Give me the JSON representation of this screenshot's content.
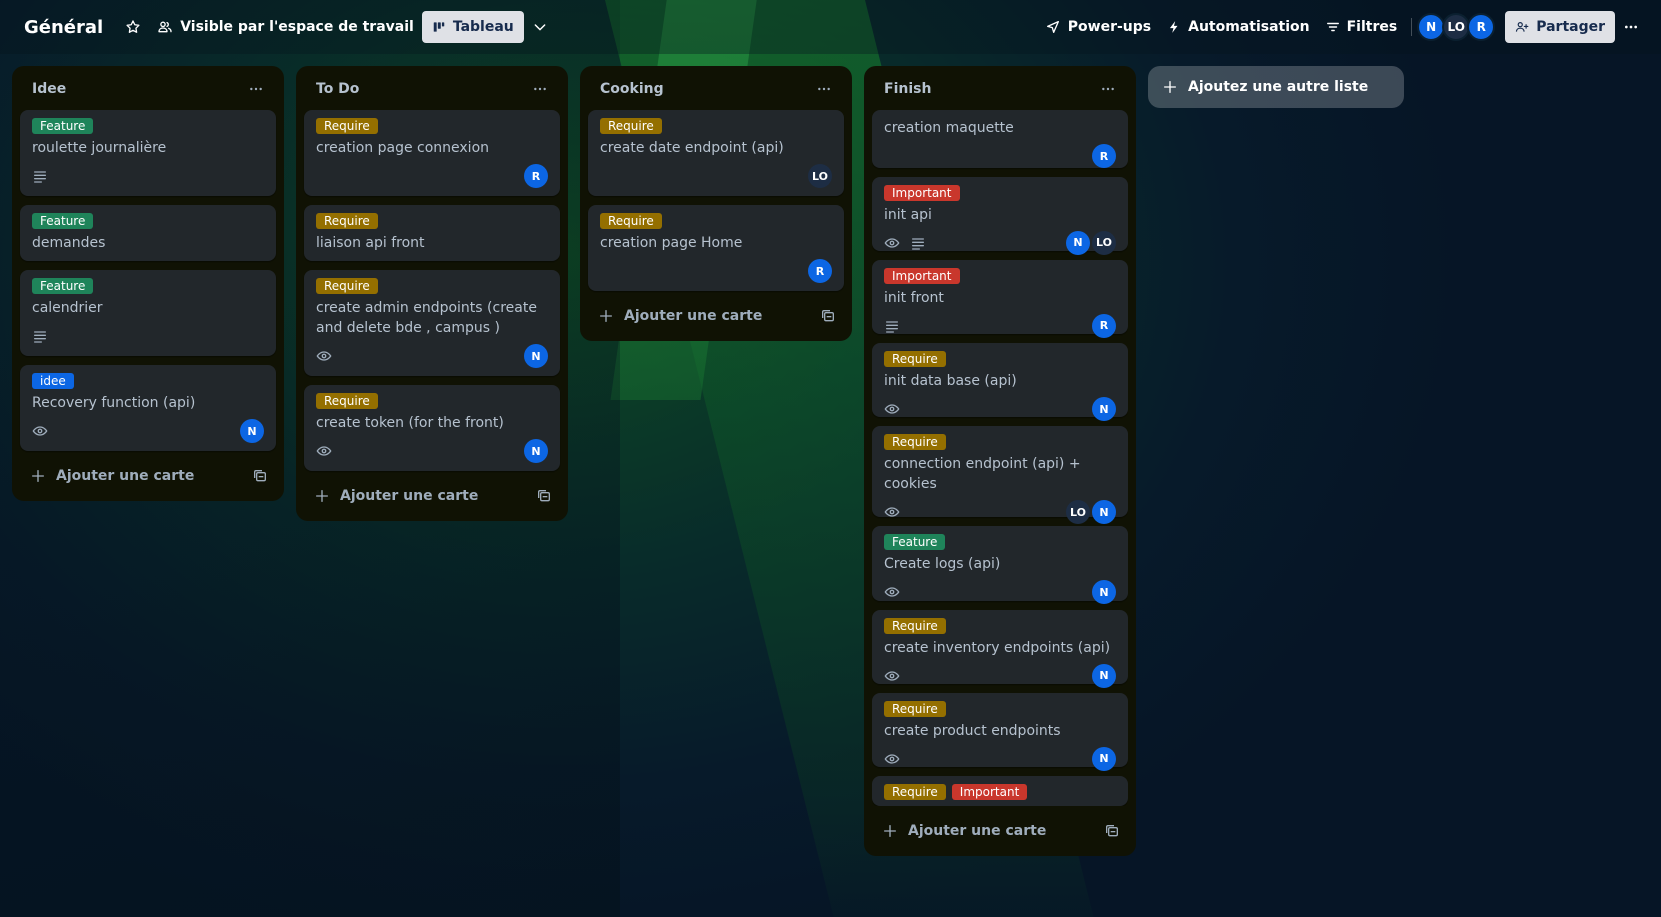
{
  "header": {
    "board_title": "Général",
    "visibility_label": "Visible par l'espace de travail",
    "view_label": "Tableau",
    "powerups_label": "Power-ups",
    "automation_label": "Automatisation",
    "filters_label": "Filtres",
    "share_label": "Partager",
    "members": [
      {
        "initials": "N",
        "color": "#0c66e4"
      },
      {
        "initials": "LO",
        "color": "#1d2d44"
      },
      {
        "initials": "R",
        "color": "#0c66e4"
      }
    ]
  },
  "colors": {
    "feature": "#1f845a",
    "require": "#946f00",
    "important": "#c9372c",
    "idee": "#0c66e4",
    "avatar_blue": "#0c66e4",
    "avatar_dark": "#1d2d44"
  },
  "add_card_label": "Ajouter une carte",
  "add_list_label": "Ajoutez une autre liste",
  "lists": [
    {
      "title": "Idee",
      "cards": [
        {
          "labels": [
            {
              "text": "Feature",
              "color": "#1f845a"
            }
          ],
          "title": "roulette journalière",
          "badges": [
            "description-icon"
          ],
          "members": []
        },
        {
          "labels": [
            {
              "text": "Feature",
              "color": "#1f845a"
            }
          ],
          "title": "demandes",
          "badges": [],
          "members": []
        },
        {
          "labels": [
            {
              "text": "Feature",
              "color": "#1f845a"
            }
          ],
          "title": "calendrier",
          "badges": [
            "description-icon"
          ],
          "members": []
        },
        {
          "labels": [
            {
              "text": "idee",
              "color": "#0c66e4"
            }
          ],
          "title": "Recovery function (api)",
          "badges": [
            "eye-icon"
          ],
          "members": [
            "N"
          ]
        }
      ]
    },
    {
      "title": "To Do",
      "cards": [
        {
          "labels": [
            {
              "text": "Require",
              "color": "#946f00"
            }
          ],
          "title": "creation page connexion",
          "badges": [],
          "members": [
            "R"
          ]
        },
        {
          "labels": [
            {
              "text": "Require",
              "color": "#946f00"
            }
          ],
          "title": "liaison api front",
          "badges": [],
          "members": []
        },
        {
          "labels": [
            {
              "text": "Require",
              "color": "#946f00"
            }
          ],
          "title": "create admin endpoints (create and delete bde , campus )",
          "badges": [
            "eye-icon"
          ],
          "members": [
            "N"
          ]
        },
        {
          "labels": [
            {
              "text": "Require",
              "color": "#946f00"
            }
          ],
          "title": "create token (for the front)",
          "badges": [
            "eye-icon"
          ],
          "members": [
            "N"
          ]
        }
      ]
    },
    {
      "title": "Cooking",
      "cards": [
        {
          "labels": [
            {
              "text": "Require",
              "color": "#946f00"
            }
          ],
          "title": "create date endpoint (api)",
          "badges": [],
          "members": [
            "LO"
          ]
        },
        {
          "labels": [
            {
              "text": "Require",
              "color": "#946f00"
            }
          ],
          "title": "creation page Home",
          "badges": [],
          "members": [
            "R"
          ]
        }
      ]
    },
    {
      "title": "Finish",
      "cards": [
        {
          "labels": [],
          "title": "creation maquette",
          "badges": [],
          "members": [
            "R"
          ]
        },
        {
          "labels": [
            {
              "text": "Important",
              "color": "#c9372c"
            }
          ],
          "title": "init api",
          "badges": [
            "eye-icon",
            "description-icon"
          ],
          "members": [
            "N",
            "LO"
          ]
        },
        {
          "labels": [
            {
              "text": "Important",
              "color": "#c9372c"
            }
          ],
          "title": "init front",
          "badges": [
            "description-icon"
          ],
          "members": [
            "R"
          ]
        },
        {
          "labels": [
            {
              "text": "Require",
              "color": "#946f00"
            }
          ],
          "title": "init data base (api)",
          "badges": [
            "eye-icon"
          ],
          "members": [
            "N"
          ]
        },
        {
          "labels": [
            {
              "text": "Require",
              "color": "#946f00"
            }
          ],
          "title": "connection endpoint (api) + cookies",
          "badges": [
            "eye-icon"
          ],
          "members": [
            "LO",
            "N"
          ]
        },
        {
          "labels": [
            {
              "text": "Feature",
              "color": "#1f845a"
            }
          ],
          "title": "Create logs (api)",
          "badges": [
            "eye-icon"
          ],
          "members": [
            "N"
          ]
        },
        {
          "labels": [
            {
              "text": "Require",
              "color": "#946f00"
            }
          ],
          "title": "create inventory endpoints (api)",
          "badges": [
            "eye-icon"
          ],
          "members": [
            "N"
          ]
        },
        {
          "labels": [
            {
              "text": "Require",
              "color": "#946f00"
            }
          ],
          "title": "create product endpoints",
          "badges": [
            "eye-icon"
          ],
          "members": [
            "N"
          ]
        },
        {
          "labels": [
            {
              "text": "Require",
              "color": "#946f00"
            },
            {
              "text": "Important",
              "color": "#c9372c"
            }
          ],
          "title": "",
          "badges": [],
          "members": []
        }
      ]
    }
  ]
}
